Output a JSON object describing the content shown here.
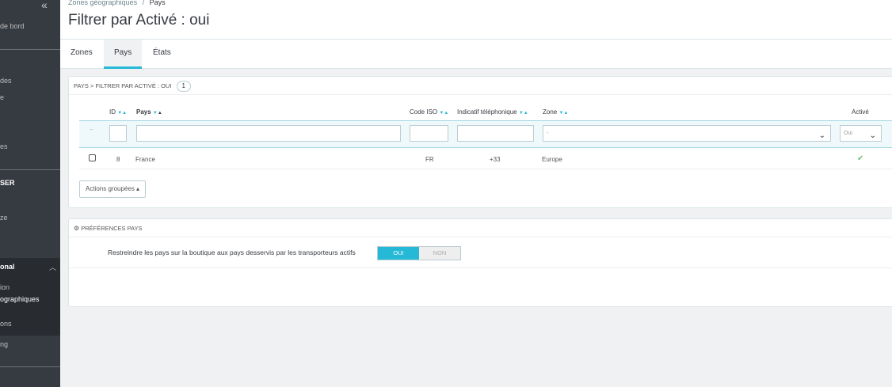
{
  "sidebar": {
    "collapse_icon": "«",
    "items": [
      {
        "label": "de bord"
      },
      {
        "label": "des"
      },
      {
        "label": "e"
      },
      {
        "label": "es"
      },
      {
        "label": "SER"
      },
      {
        "label": "ze"
      },
      {
        "label": "onal"
      },
      {
        "label": "ion"
      },
      {
        "label": "ographiques"
      },
      {
        "label": "ons"
      },
      {
        "label": "ng"
      }
    ]
  },
  "breadcrumb": {
    "parent": "Zones géographiques",
    "separator": "/",
    "current": "Pays"
  },
  "page_title": "Filtrer par Activé : oui",
  "tabs": [
    {
      "label": "Zones"
    },
    {
      "label": "Pays"
    },
    {
      "label": "États"
    }
  ],
  "list_panel": {
    "heading": "PAYS > FILTRER PAR ACTIVÉ : OUI",
    "count": "1",
    "columns": {
      "id": "ID",
      "pays": "Pays",
      "code_iso": "Code ISO",
      "indicatif": "Indicatif téléphonique",
      "zone": "Zone",
      "active": "Activé"
    },
    "filters": {
      "dots": "--",
      "zone_value": "-",
      "active_value": "Oui"
    },
    "rows": [
      {
        "id": "8",
        "pays": "France",
        "code_iso": "FR",
        "indicatif": "+33",
        "zone": "Europe",
        "active": "✔"
      }
    ],
    "bulk_label": "Actions groupées ▴"
  },
  "pref_panel": {
    "heading": "PRÉFÉRENCES PAYS",
    "label": "Restreindre les pays sur la boutique aux pays desservis par les transporteurs actifs",
    "on": "OUI",
    "off": "NON"
  }
}
